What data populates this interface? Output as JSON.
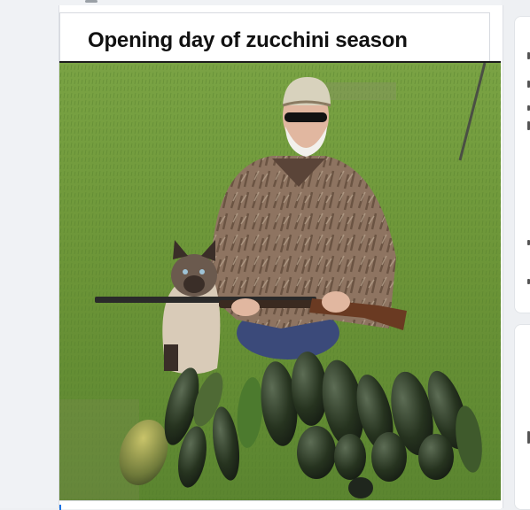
{
  "post": {
    "caption": "Opening day of zucchini season"
  },
  "photo": {
    "subject": "meme-photo",
    "colors": {
      "grass": "#6f9a3c",
      "grass_dark": "#4f7a2a",
      "camo": "#8b6f5c",
      "zucchini": "#2b3a2a",
      "cat_body": "#d9cbb8",
      "cat_points": "#3a2e28"
    }
  }
}
